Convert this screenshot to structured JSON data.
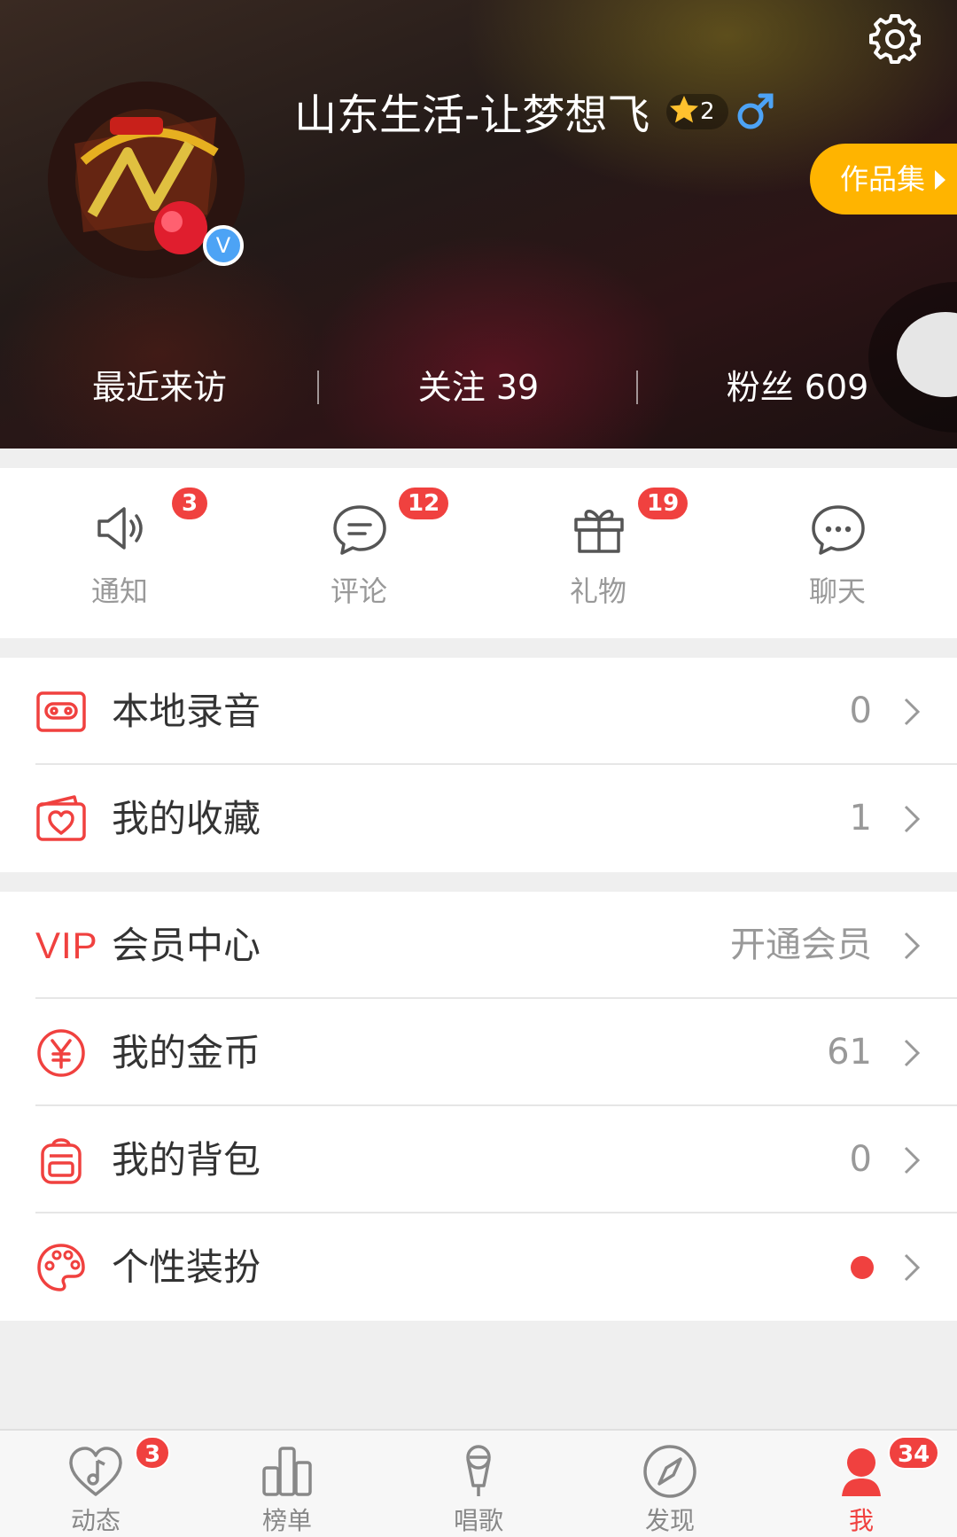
{
  "colors": {
    "accent": "#f0413f",
    "works_button": "#ffb400",
    "verify": "#4da3f5",
    "male": "#4da3f5"
  },
  "profile": {
    "username": "山东生活-让梦想飞",
    "level": "2",
    "gender_icon": "male-icon",
    "verified_icon": "verified-v-icon",
    "works_button": "作品集",
    "stats": {
      "visitors": "最近来访",
      "following": "关注 39",
      "fans": "粉丝 609"
    }
  },
  "quick_actions": [
    {
      "label": "通知",
      "icon": "speaker-icon",
      "badge": "3"
    },
    {
      "label": "评论",
      "icon": "comment-icon",
      "badge": "12"
    },
    {
      "label": "礼物",
      "icon": "gift-icon",
      "badge": "19"
    },
    {
      "label": "聊天",
      "icon": "chat-icon",
      "badge": ""
    }
  ],
  "menu": {
    "group1": [
      {
        "label": "本地录音",
        "value": "0",
        "icon": "cassette-icon"
      },
      {
        "label": "我的收藏",
        "value": "1",
        "icon": "heart-folder-icon"
      }
    ],
    "group2": [
      {
        "label": "会员中心",
        "value": "开通会员",
        "icon_text": "VIP"
      },
      {
        "label": "我的金币",
        "value": "61",
        "icon": "yuan-coin-icon"
      },
      {
        "label": "我的背包",
        "value": "0",
        "icon": "backpack-icon"
      },
      {
        "label": "个性装扮",
        "value": "",
        "icon": "palette-icon",
        "dot": true
      }
    ]
  },
  "bottom_nav": [
    {
      "label": "动态",
      "icon": "music-heart-icon",
      "badge": "3"
    },
    {
      "label": "榜单",
      "icon": "chart-bars-icon",
      "badge": ""
    },
    {
      "label": "唱歌",
      "icon": "microphone-icon",
      "badge": ""
    },
    {
      "label": "发现",
      "icon": "compass-icon",
      "badge": ""
    },
    {
      "label": "我",
      "icon": "profile-icon",
      "badge": "34",
      "active": true
    }
  ]
}
